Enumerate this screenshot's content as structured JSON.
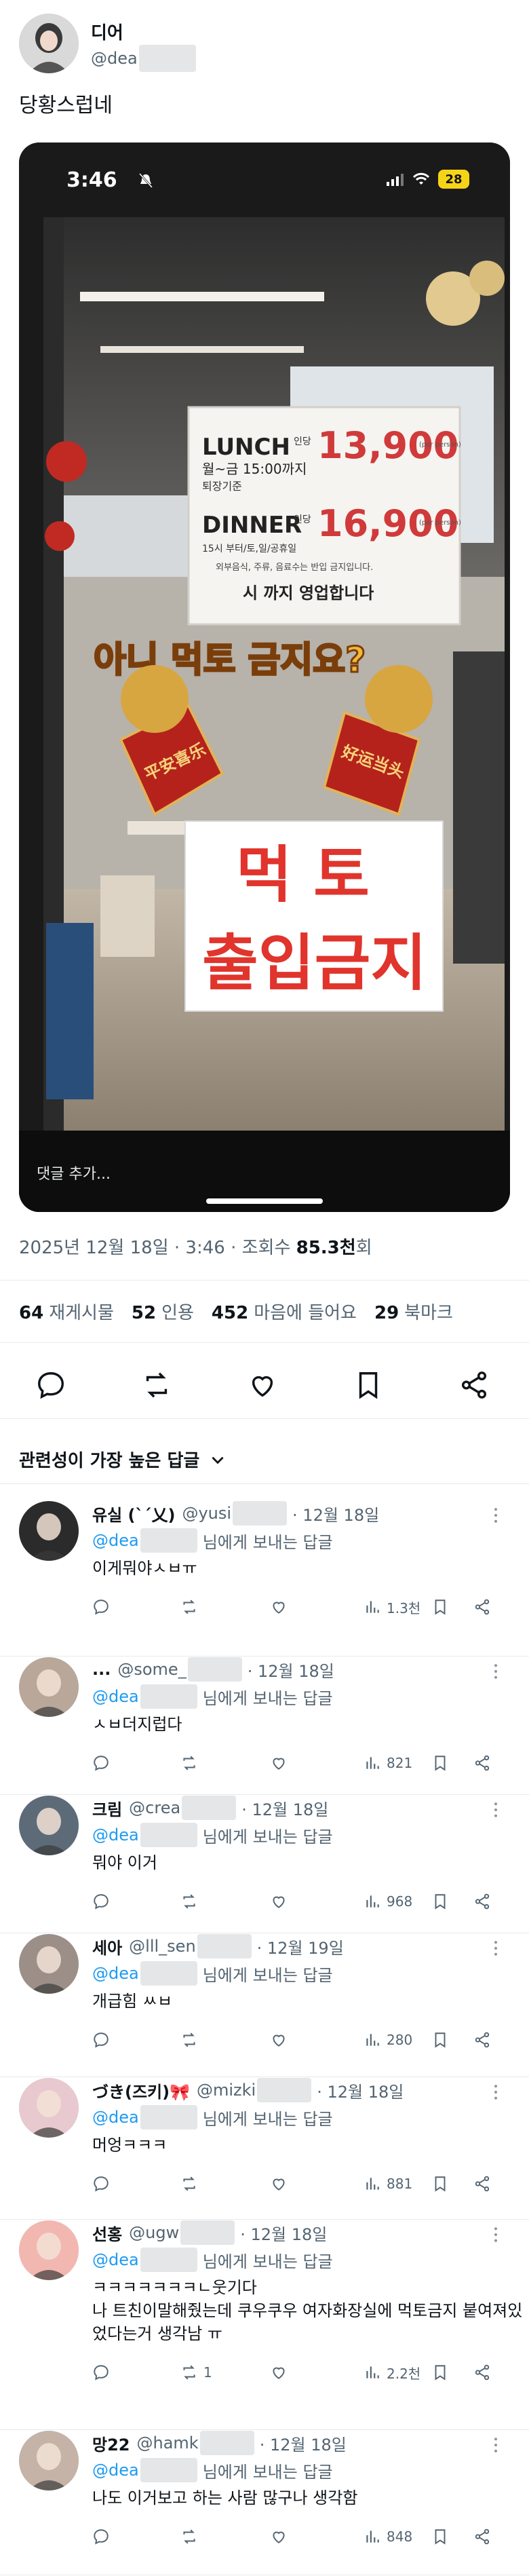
{
  "author": {
    "name": "디어",
    "handle": "@dea"
  },
  "tweet": {
    "text": "당황스럽네"
  },
  "media": {
    "status_time": "3:46",
    "battery": "28",
    "menu": {
      "lunch_label": "LUNCH",
      "lunch_note1": "월~금 15:00까지",
      "lunch_note2": "퇴장기준",
      "lunch_per": "인당",
      "lunch_price": "13,900",
      "dinner_label": "DINNER",
      "dinner_note": "15시 부터/토,일/공휴일",
      "dinner_per": "인당",
      "dinner_price": "16,900",
      "notice": "외부음식, 주류, 음료수는 반입 금지입니다.",
      "hours": "시 까지 영업합니다",
      "per_person": "(per person)"
    },
    "overlay_caption": "아니 먹토 금지요?",
    "banner_left": "平安喜乐",
    "banner_right": "好运当头",
    "sign_line1": "먹 토",
    "sign_line2": "출입금지",
    "reply_placeholder": "댓글 추가..."
  },
  "meta": {
    "date": "2025년 12월 18일 · 3:46 · 조회수 ",
    "views": "85.3천",
    "views_suffix": "회"
  },
  "stats": [
    {
      "count": "64",
      "label": "재게시물"
    },
    {
      "count": "52",
      "label": "인용"
    },
    {
      "count": "452",
      "label": "마음에 들어요"
    },
    {
      "count": "29",
      "label": "북마크"
    }
  ],
  "sort": {
    "label": "관련성이 가장 높은 답글"
  },
  "replies": [
    {
      "name": "유실 (ˋˊ乂)",
      "handle": "@yusi",
      "date": "· 12월 18일",
      "mention": "@dea",
      "replying": "님에게 보내는 답글",
      "body": "이게뭐야ㅅㅂㅠ",
      "comments": "",
      "retweets": "",
      "views": "1.3천",
      "avatar_color": "#2b2b2b"
    },
    {
      "name": "...",
      "handle": "@some_",
      "date": "· 12월 18일",
      "mention": "@dea",
      "replying": "님에게 보내는 답글",
      "body": "ㅅㅂ더지럽다",
      "comments": "",
      "retweets": "",
      "views": "821",
      "avatar_color": "#b9a79a"
    },
    {
      "name": "크림",
      "handle": "@crea",
      "date": "· 12월 18일",
      "mention": "@dea",
      "replying": "님에게 보내는 답글",
      "body": "뭐야 이거",
      "comments": "",
      "retweets": "",
      "views": "968",
      "avatar_color": "#5d6b78"
    },
    {
      "name": "세아",
      "handle": "@lll_sen",
      "date": "· 12월 19일",
      "mention": "@dea",
      "replying": "님에게 보내는 답글",
      "body": "개급힘 ㅆㅂ",
      "comments": "",
      "retweets": "",
      "views": "280",
      "avatar_color": "#9c8f88"
    },
    {
      "name": "づき(즈키)🎀",
      "handle": "@mizki",
      "date": "· 12월 18일",
      "mention": "@dea",
      "replying": "님에게 보내는 답글",
      "body": "머엉ㅋㅋㅋ",
      "comments": "",
      "retweets": "",
      "views": "881",
      "avatar_color": "#e8c9cf"
    },
    {
      "name": "선홍",
      "handle": "@ugw",
      "date": "· 12월 18일",
      "mention": "@dea",
      "replying": "님에게 보내는 답글",
      "body": "ㅋㅋㅋㅋㅋㅋㅋㄴ웃기다\n나 트친이말해줬는데 쿠우쿠우 여자화장실에 먹토금지 붙여져있었다는거 생각남 ㅠ",
      "comments": "",
      "retweets": "1",
      "views": "2.2천",
      "avatar_color": "#f2b7b0"
    },
    {
      "name": "망22",
      "handle": "@hamk",
      "date": "· 12월 18일",
      "mention": "@dea",
      "replying": "님에게 보내는 답글",
      "body": "나도 이거보고 하는 사람 많구나 생각함",
      "comments": "",
      "retweets": "",
      "views": "848",
      "avatar_color": "#c4b3a6"
    }
  ]
}
